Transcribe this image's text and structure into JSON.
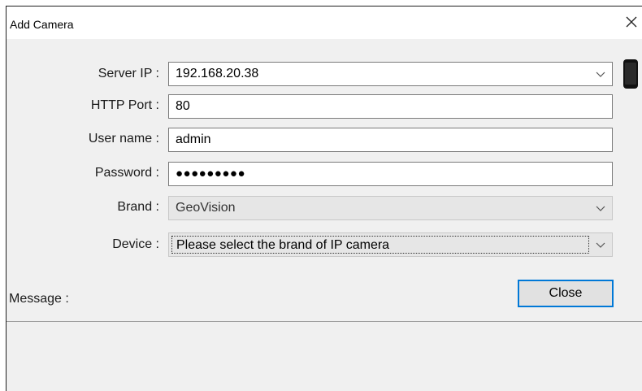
{
  "window": {
    "title": "Add Camera"
  },
  "form": {
    "server_ip": {
      "label": "Server IP :",
      "value": "192.168.20.38"
    },
    "http_port": {
      "label": "HTTP Port :",
      "value": "80"
    },
    "user_name": {
      "label": "User name :",
      "value": "admin"
    },
    "password": {
      "label": "Password :",
      "value": "●●●●●●●●●"
    },
    "brand": {
      "label": "Brand :",
      "value": "GeoVision"
    },
    "device": {
      "label": "Device :",
      "value": "Please select the brand of IP camera"
    }
  },
  "buttons": {
    "close_label": "Close"
  },
  "message": {
    "label": "Message :"
  },
  "colors": {
    "focus_border": "#0078d7",
    "background": "#f0f0f0"
  }
}
